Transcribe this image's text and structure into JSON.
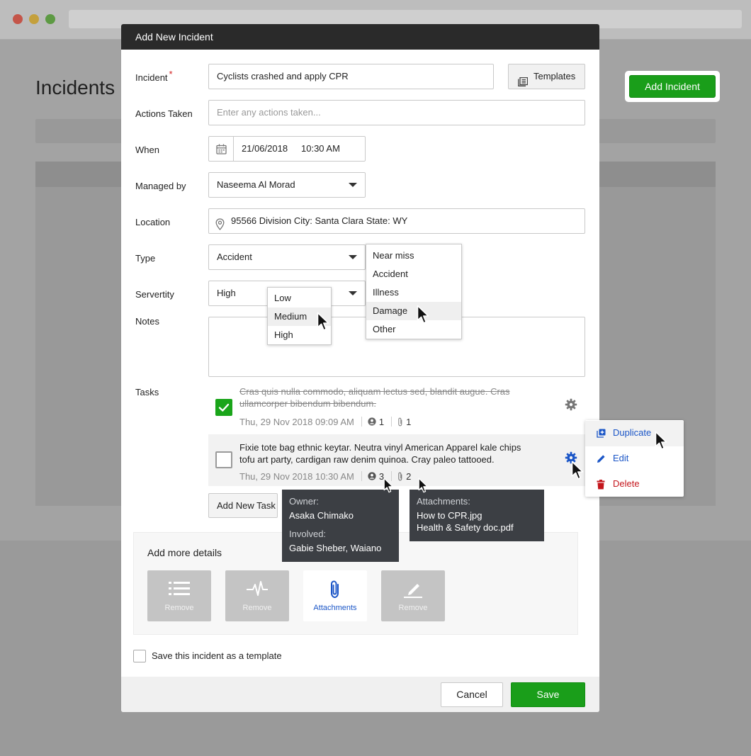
{
  "background": {
    "page_title": "Incidents",
    "add_incident_label": "Add Incident"
  },
  "modal": {
    "title": "Add New Incident",
    "fields": {
      "incident_label": "Incident",
      "required_mark": "*",
      "incident_value": "Cyclists crashed and apply CPR",
      "templates_label": "Templates",
      "actions_label": "Actions Taken",
      "actions_placeholder": "Enter any actions taken...",
      "when_label": "When",
      "when_date": "21/06/2018",
      "when_time": "10:30 AM",
      "managed_label": "Managed by",
      "managed_value": "Naseema Al Morad",
      "location_label": "Location",
      "location_value": "95566 Division City: Santa Clara State: WY",
      "type_label": "Type",
      "type_value": "Accident",
      "severity_label": "Servertity",
      "severity_value": "High",
      "notes_label": "Notes"
    },
    "tasks": {
      "label": "Tasks",
      "items": [
        {
          "text": "Cras quis nulla commodo, aliquam lectus sed, blandit augue. Cras ullamcorper bibendum bibendum.",
          "date": "Thu, 29 Nov 2018 09:09 AM",
          "people": "1",
          "attachments": "1",
          "done": true
        },
        {
          "text": "Fixie tote bag ethnic keytar. Neutra vinyl American Apparel kale chips tofu art party, cardigan raw denim quinoa. Cray paleo tattooed.",
          "date": "Thu, 29 Nov 2018 10:30 AM",
          "people": "3",
          "attachments": "2",
          "done": false
        }
      ],
      "add_label": "Add New Task"
    },
    "details": {
      "title": "Add more details",
      "tiles": [
        {
          "label": "Remove",
          "icon": "list-icon",
          "active": false
        },
        {
          "label": "Remove",
          "icon": "pulse-icon",
          "active": false
        },
        {
          "label": "Attachments",
          "icon": "paperclip-icon",
          "active": true
        },
        {
          "label": "Remove",
          "icon": "signature-icon",
          "active": false
        }
      ]
    },
    "save_template_label": "Save this incident as a template",
    "cancel_label": "Cancel",
    "save_label": "Save"
  },
  "type_dropdown": {
    "options": [
      "Near miss",
      "Accident",
      "Illness",
      "Damage",
      "Other"
    ],
    "hovered": "Damage"
  },
  "severity_dropdown": {
    "options": [
      "Low",
      "Medium",
      "High"
    ],
    "hovered": "Medium"
  },
  "context_menu": {
    "items": [
      {
        "label": "Duplicate",
        "icon": "duplicate-icon"
      },
      {
        "label": "Edit",
        "icon": "pencil-icon"
      },
      {
        "label": "Delete",
        "icon": "trash-icon"
      }
    ]
  },
  "owner_tooltip": {
    "owner_key": "Owner:",
    "owner_value": "Asaka Chimako",
    "involved_key": "Involved:",
    "involved_value": "Gabie Sheber, Waiano"
  },
  "attachments_tooltip": {
    "key": "Attachments:",
    "files": [
      "How to CPR.jpg",
      "Health & Safety doc.pdf"
    ]
  },
  "colors": {
    "accent_green": "#1a9e1a",
    "link_blue": "#1b56c7",
    "danger_red": "#c4161c",
    "header_dark": "#2a2a2a"
  }
}
